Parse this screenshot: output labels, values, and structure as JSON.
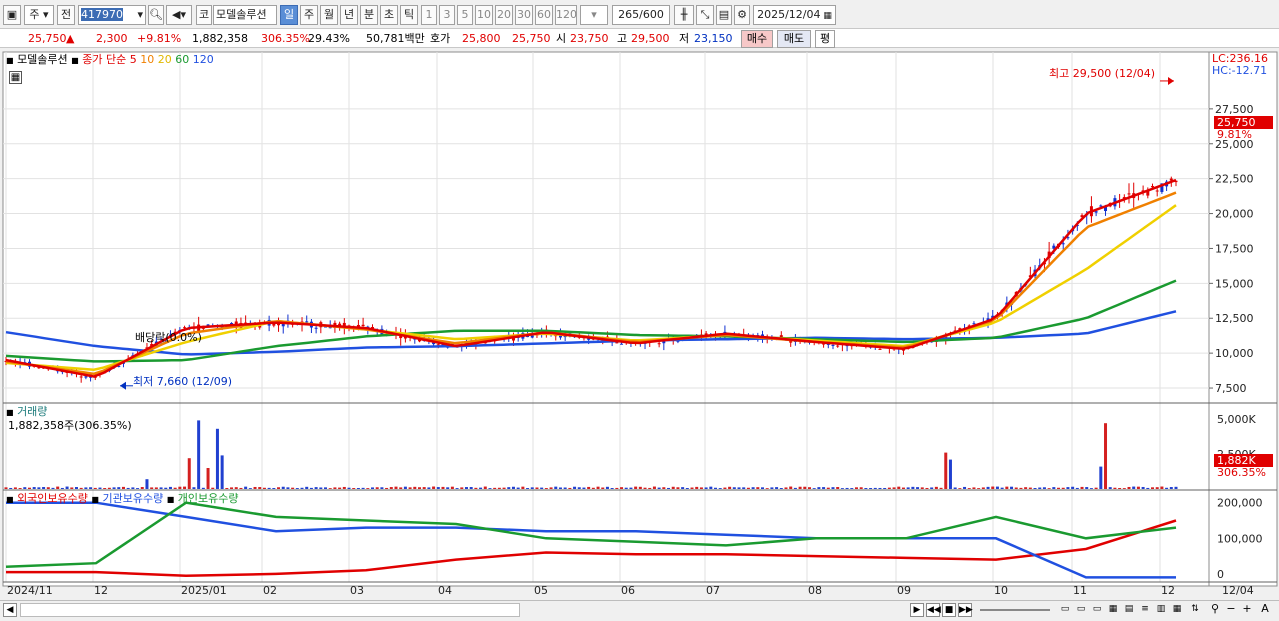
{
  "toolbar": {
    "stock_type": "주",
    "market": "전",
    "code": "417970",
    "name": "모델솔루션",
    "exchange": "코",
    "periods": [
      "일",
      "주",
      "월",
      "년",
      "분",
      "초",
      "틱"
    ],
    "active_period": "일",
    "intervals": [
      "1",
      "3",
      "5",
      "10",
      "20",
      "30",
      "60",
      "120"
    ],
    "count": "265",
    "count_max": "/600",
    "date": "2025/12/04"
  },
  "quote": {
    "price": "25,750",
    "arrow": "▲",
    "change": "2,300",
    "change_pct": "+9.81%",
    "volume": "1,882,358",
    "volume_ratio": "306.35%",
    "turnover_pct": "29.43%",
    "amount": "50,781백만",
    "bid_label": "호가",
    "bid": "25,800",
    "ask": "25,750",
    "open_label": "시",
    "open": "23,750",
    "high_label": "고",
    "high": "29,500",
    "low_label": "저",
    "low": "23,150",
    "buy_btn": "매수",
    "sell_btn": "매도",
    "eval_btn": "평"
  },
  "price_panel": {
    "name_label": "모델솔루션",
    "ma_label": "종가 단순",
    "ma_periods": [
      "5",
      "10",
      "20",
      "60",
      "120"
    ],
    "ma_colors": [
      "#e00000",
      "#f08000",
      "#f0d000",
      "#1a9a30",
      "#2050e0"
    ],
    "lc_label": "LC:236.16",
    "hc_label": "HC:-12.71",
    "current_price_tag": "25,750",
    "current_pct_tag": "9.81%",
    "high_annotation": "최고 29,500 (12/04)",
    "low_annotation": "최저 7,660 (12/09)",
    "dividend_annotation": "배당락(0.0%)",
    "y_ticks": [
      "27,500",
      "25,000",
      "22,500",
      "20,000",
      "17,500",
      "15,000",
      "12,500",
      "10,000",
      "7,500"
    ]
  },
  "volume_panel": {
    "title": "거래량",
    "value_label": "1,882,358주(306.35%)",
    "y_ticks": [
      "5,000K",
      "2,500K"
    ],
    "current_tag": "1,882K",
    "current_pct": "306.35%"
  },
  "holding_panel": {
    "legend": [
      "외국인보유수량",
      "기관보유수량",
      "개인보유수량"
    ],
    "legend_colors": [
      "#e00000",
      "#2050e0",
      "#1a9a30"
    ],
    "y_ticks": [
      "200,000",
      "100,000",
      "0"
    ]
  },
  "x_axis": {
    "labels": [
      "2024/11",
      "12",
      "2025/01",
      "02",
      "03",
      "04",
      "05",
      "06",
      "07",
      "08",
      "09",
      "10",
      "11",
      "12"
    ],
    "right_label": "12/04"
  },
  "chart_data": {
    "type": "line",
    "x": [
      "2024/11",
      "12",
      "2025/01",
      "02",
      "03",
      "04",
      "05",
      "06",
      "07",
      "08",
      "09",
      "10",
      "11",
      "12/04"
    ],
    "series": [
      {
        "name": "5",
        "values": [
          9500,
          8300,
          11800,
          12200,
          11800,
          10500,
          11500,
          10700,
          11400,
          10800,
          10300,
          12500,
          20000,
          22400
        ]
      },
      {
        "name": "10",
        "values": [
          9400,
          8500,
          11400,
          12300,
          11700,
          10700,
          11500,
          10800,
          11300,
          10800,
          10400,
          12400,
          19000,
          21500
        ]
      },
      {
        "name": "20",
        "values": [
          9300,
          8800,
          10800,
          12300,
          11700,
          11000,
          11400,
          10900,
          11300,
          10900,
          10500,
          12200,
          16000,
          20600
        ]
      },
      {
        "name": "60",
        "values": [
          9800,
          9400,
          9500,
          10500,
          11200,
          11600,
          11600,
          11300,
          11200,
          11000,
          10800,
          11100,
          12500,
          15200
        ]
      },
      {
        "name": "120",
        "values": [
          11500,
          10500,
          9900,
          10100,
          10400,
          10500,
          10700,
          10900,
          11000,
          11100,
          11000,
          11100,
          11400,
          13000
        ]
      }
    ],
    "ylim": [
      6500,
      31000
    ],
    "high": {
      "value": 29500,
      "date": "12/04"
    },
    "low": {
      "value": 7660,
      "date": "12/09"
    },
    "volume_ylim": [
      0,
      6000
    ],
    "holding_series": [
      {
        "name": "외국인보유수량",
        "values": [
          5000,
          5000,
          -5000,
          0,
          10000,
          40000,
          60000,
          55000,
          55000,
          50000,
          45000,
          40000,
          70000,
          150000
        ]
      },
      {
        "name": "기관보유수량",
        "values": [
          200000,
          200000,
          160000,
          120000,
          130000,
          130000,
          120000,
          120000,
          110000,
          100000,
          100000,
          100000,
          -10000,
          -10000
        ]
      },
      {
        "name": "개인보유수량",
        "values": [
          20000,
          30000,
          200000,
          160000,
          150000,
          140000,
          100000,
          90000,
          80000,
          100000,
          100000,
          160000,
          100000,
          130000
        ]
      }
    ],
    "holding_ylim": [
      -20000,
      230000
    ]
  }
}
